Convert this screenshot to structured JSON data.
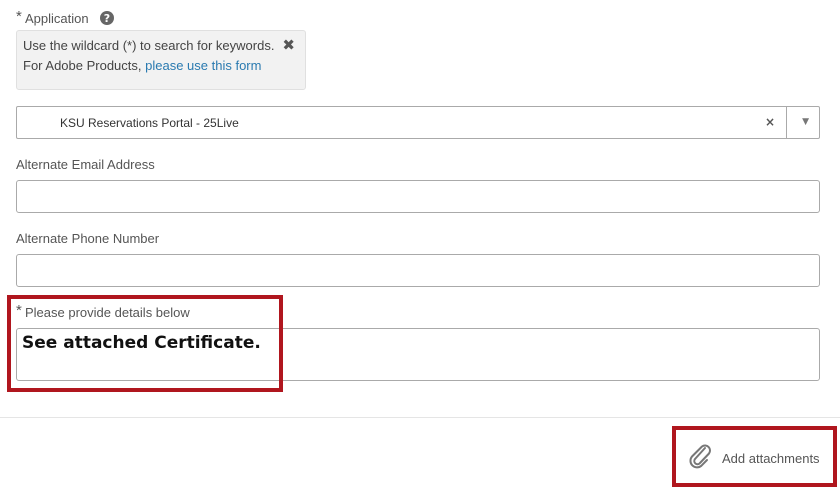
{
  "application": {
    "required_mark": "*",
    "label": "Application",
    "help_icon": "?",
    "info": {
      "line1": "Use the wildcard (*) to search for keywords.",
      "line2_prefix": "For Adobe Products, ",
      "line2_link": "please use this form",
      "close": "✖"
    },
    "selected_value": "KSU Reservations Portal - 25Live",
    "clear": "×",
    "dropdown_arrow": "▼"
  },
  "alternate_email": {
    "label": "Alternate Email Address",
    "value": ""
  },
  "alternate_phone": {
    "label": "Alternate Phone Number",
    "value": ""
  },
  "details": {
    "required_mark": "*",
    "label": "Please provide details below",
    "value": "See attached Certificate."
  },
  "attachments": {
    "label": "Add attachments",
    "icon": "paperclip-icon"
  },
  "colors": {
    "highlight": "#b0161e",
    "link": "#2a7ab0"
  }
}
